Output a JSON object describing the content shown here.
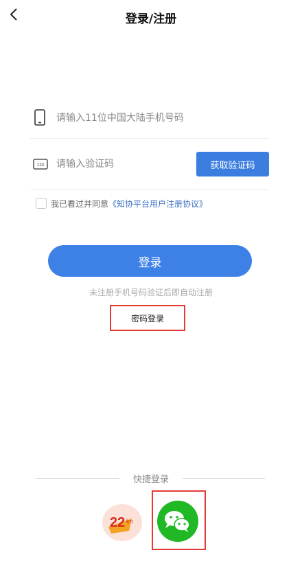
{
  "header": {
    "title": "登录/注册",
    "back_icon": "chevron-left-icon"
  },
  "phone": {
    "placeholder": "请输入11位中国大陆手机号码",
    "value": "",
    "icon": "phone-icon"
  },
  "code": {
    "placeholder": "请输入验证码",
    "value": "",
    "icon": "keypad-123-icon",
    "get_code_label": "获取验证码"
  },
  "agreement": {
    "checked": false,
    "prefix": "我已看过并同意",
    "link": "《知协平台用户注册协议》"
  },
  "login": {
    "label": "登录",
    "note": "未注册手机号码验证后即自动注册"
  },
  "password_login": {
    "label": "密码登录"
  },
  "quick_login": {
    "label": "快捷登录",
    "providers": [
      "app-logo",
      "wechat"
    ]
  },
  "colors": {
    "primary": "#3d80e6",
    "link": "#3c6fc4",
    "wechat": "#20b824",
    "highlight": "#e53935"
  }
}
